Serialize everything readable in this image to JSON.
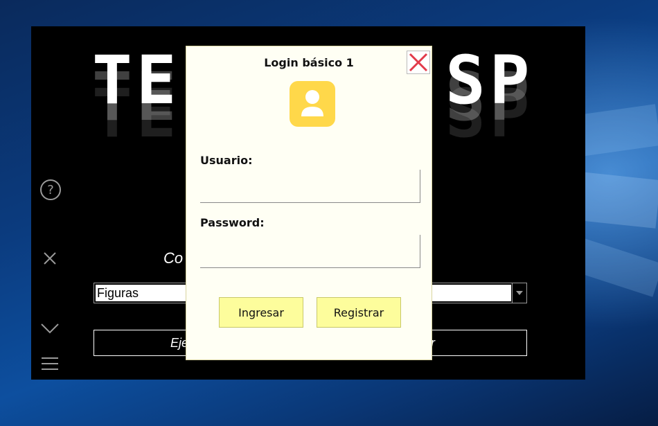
{
  "app": {
    "logo_left": "TE",
    "logo_right": "SP",
    "combo_caption": "Co",
    "select": {
      "value": "Figuras"
    },
    "run_button": {
      "left_text": "Eje",
      "right_text": "ar"
    }
  },
  "dialog": {
    "title": "Login básico 1",
    "user_label": "Usuario:",
    "user_value": "",
    "password_label": "Password:",
    "password_value": "",
    "login_button": "Ingresar",
    "register_button": "Registrar"
  },
  "colors": {
    "dialog_bg": "#fffff4",
    "button_bg": "#fdfd9c",
    "user_icon_bg": "#ffd84a",
    "close_x": "#e23a4a"
  }
}
